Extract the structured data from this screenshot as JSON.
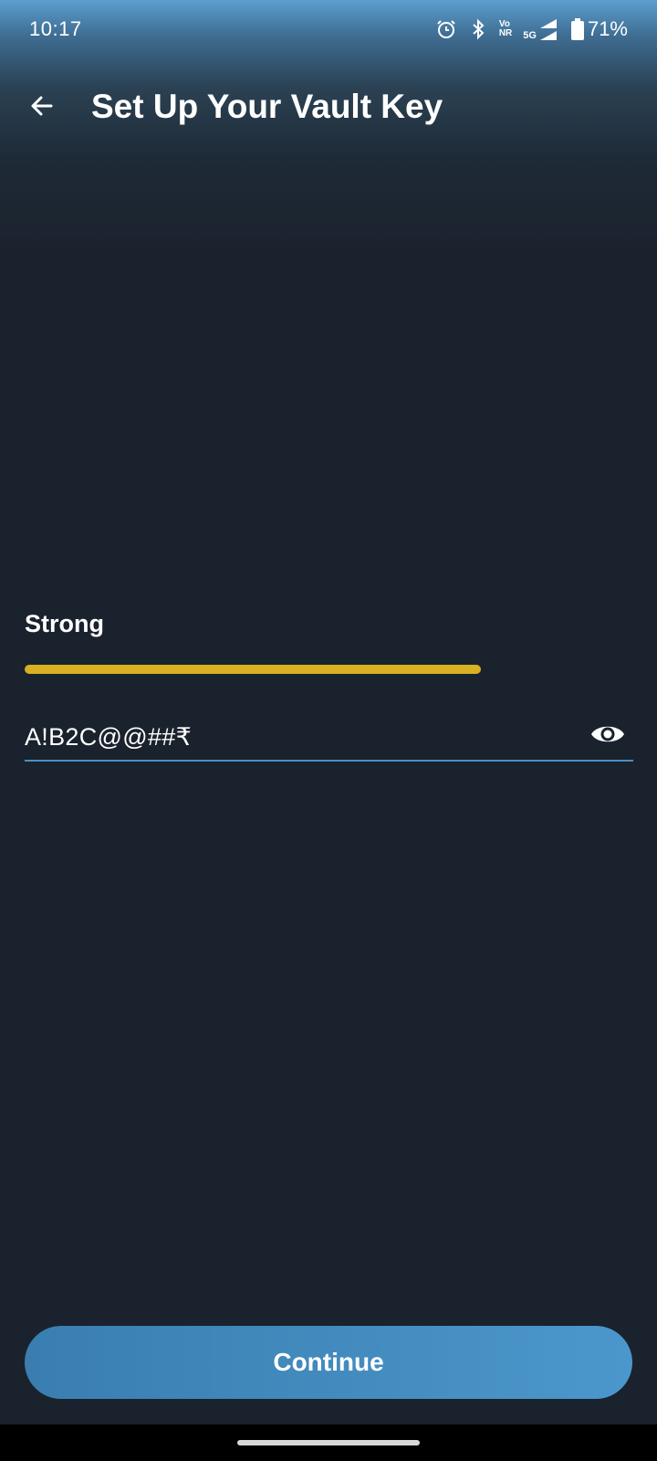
{
  "status_bar": {
    "time": "10:17",
    "network_volte": "Vo",
    "network_nr": "NR",
    "network_5g": "5G",
    "battery_percent": "71%",
    "icons": [
      "alarm-icon",
      "bluetooth-icon",
      "volte-icon",
      "signal-icon",
      "battery-icon"
    ]
  },
  "header": {
    "title": "Set Up Your Vault Key",
    "back_icon": "arrow-left-icon"
  },
  "strength": {
    "label": "Strong",
    "level": 0.75,
    "color": "#d8b021"
  },
  "password_field": {
    "value": "A!B2C@@##₹",
    "visibility_icon": "eye-icon"
  },
  "footer": {
    "continue_label": "Continue"
  },
  "colors": {
    "background": "#1a222d",
    "accent": "#4a8fc4",
    "button": "#4b97cc"
  }
}
